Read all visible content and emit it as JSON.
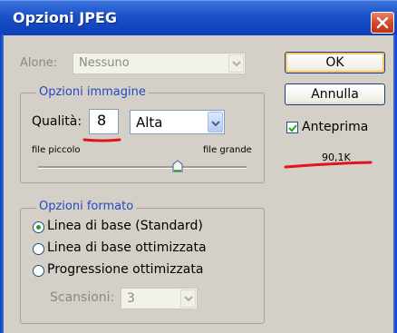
{
  "window": {
    "title": "Opzioni JPEG"
  },
  "matte": {
    "label": "Alone:",
    "value": "Nessuno"
  },
  "buttons": {
    "ok": "OK",
    "cancel": "Annulla"
  },
  "preview": {
    "label": "Anteprima",
    "checked": true,
    "size": "90,1K"
  },
  "image_options": {
    "title": "Opzioni immagine",
    "quality_label": "Qualità:",
    "quality_value": "8",
    "quality_preset": "Alta",
    "small_file_label": "file piccolo",
    "large_file_label": "file grande",
    "slider_level_fraction": 0.67
  },
  "format_options": {
    "title": "Opzioni formato",
    "options": [
      {
        "label": "Linea di base (Standard)",
        "selected": true
      },
      {
        "label": "Linea di base ottimizzata",
        "selected": false
      },
      {
        "label": "Progressione ottimizzata",
        "selected": false
      }
    ],
    "scans_label": "Scansioni:",
    "scans_value": "3"
  },
  "colors": {
    "annotation": "#e1141e",
    "title_bar": "#1a50c8",
    "group_title": "#2349c4"
  }
}
